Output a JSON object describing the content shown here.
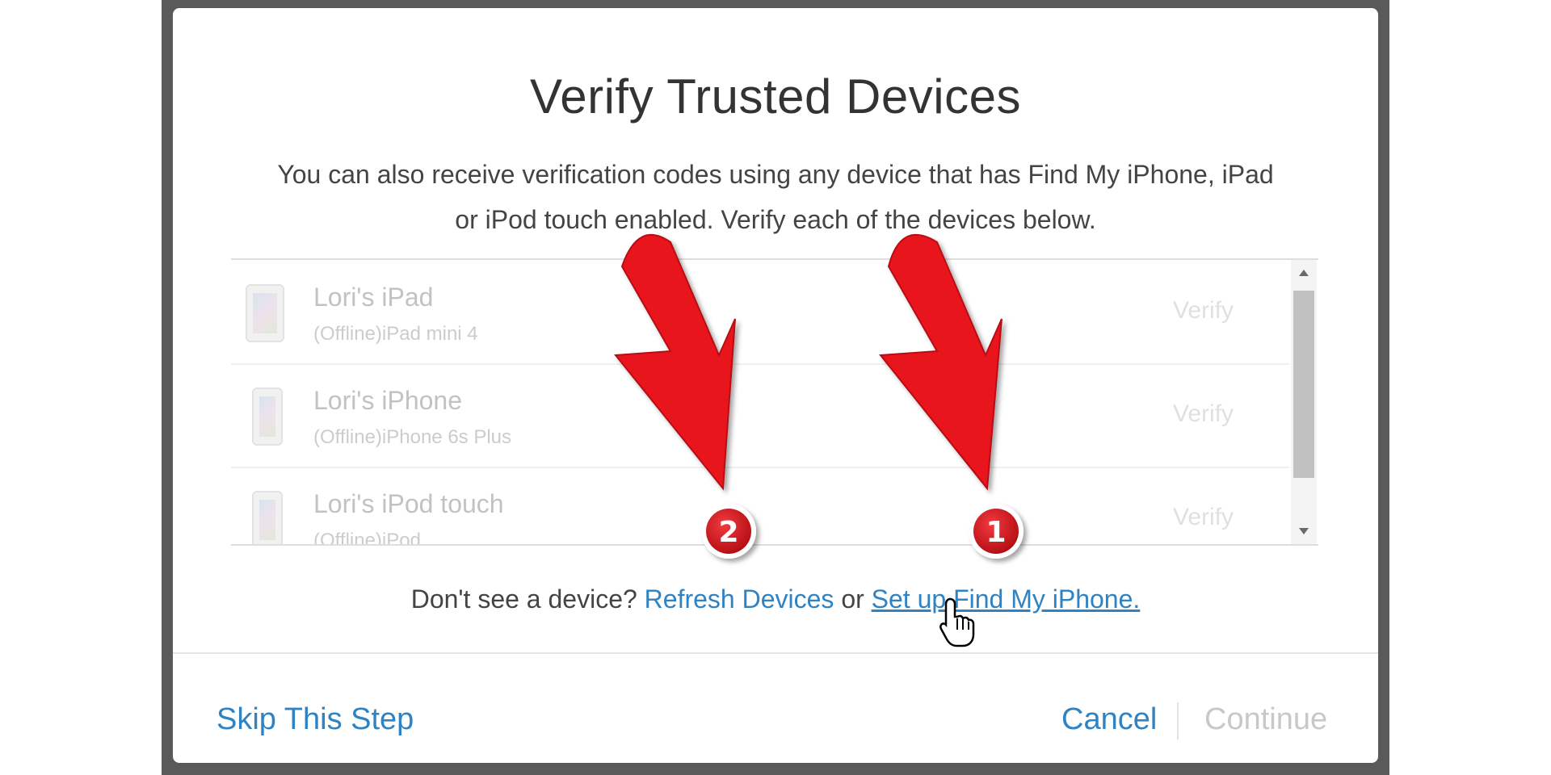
{
  "dialog": {
    "title": "Verify Trusted Devices",
    "description_line1": "You can also receive verification codes using any device that has Find My iPhone, iPad",
    "description_line2": "or iPod touch enabled. Verify each of the devices below."
  },
  "devices": [
    {
      "name": "Lori's iPad",
      "model": "(Offline)iPad mini 4",
      "action": "Verify",
      "icon": "ipad-icon"
    },
    {
      "name": "Lori's iPhone",
      "model": "(Offline)iPhone 6s Plus",
      "action": "Verify",
      "icon": "iphone-icon"
    },
    {
      "name": "Lori's iPod touch",
      "model": "(Offline)iPod",
      "action": "Verify",
      "icon": "ipod-icon"
    }
  ],
  "help": {
    "prefix": "Don't see a device?",
    "refresh_link": "Refresh Devices",
    "or": "or",
    "setup_link": "Set up Find My iPhone."
  },
  "footer": {
    "skip": "Skip This Step",
    "cancel": "Cancel",
    "continue": "Continue"
  },
  "annotations": {
    "badge_1": "1",
    "badge_2": "2",
    "arrow_color": "#e8141a",
    "badge_color": "#c81017"
  },
  "colors": {
    "link": "#2f83c3",
    "disabled": "#c8c8c8"
  }
}
